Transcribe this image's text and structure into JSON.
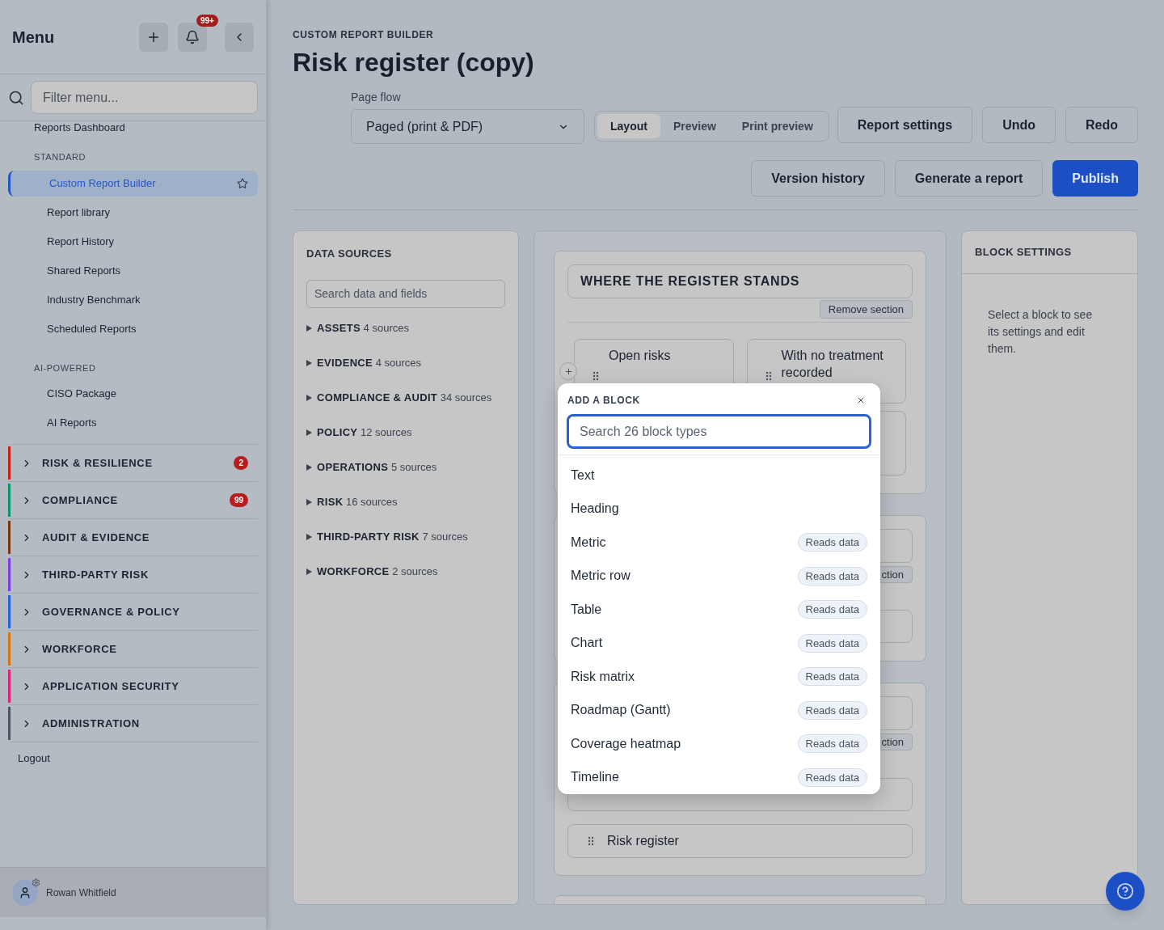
{
  "sidebar": {
    "title": "Menu",
    "notification_count": "99+",
    "filter": {
      "placeholder": "Filter menu..."
    },
    "top_link": "Reports Dashboard",
    "groups": [
      {
        "heading": "STANDARD",
        "items": [
          {
            "label": "Custom Report Builder",
            "selected": true
          },
          {
            "label": "Report library",
            "selected": false
          },
          {
            "label": "Report History",
            "selected": false
          },
          {
            "label": "Shared Reports",
            "selected": false
          },
          {
            "label": "Industry Benchmark",
            "selected": false
          },
          {
            "label": "Scheduled Reports",
            "selected": false
          }
        ]
      },
      {
        "heading": "AI-POWERED",
        "items": [
          {
            "label": "CISO Package",
            "selected": false
          },
          {
            "label": "AI Reports",
            "selected": false
          }
        ]
      }
    ],
    "sections": [
      {
        "label": "RISK & RESILIENCE",
        "color": "#c81e1e",
        "badge": "2"
      },
      {
        "label": "COMPLIANCE",
        "color": "#059669",
        "badge": "99"
      },
      {
        "label": "AUDIT & EVIDENCE",
        "color": "#78350f"
      },
      {
        "label": "THIRD-PARTY RISK",
        "color": "#7c3aed"
      },
      {
        "label": "GOVERNANCE & POLICY",
        "color": "#2563eb"
      },
      {
        "label": "WORKFORCE",
        "color": "#d97706"
      },
      {
        "label": "APPLICATION SECURITY",
        "color": "#db2777"
      },
      {
        "label": "ADMINISTRATION",
        "color": "#4b5563"
      }
    ],
    "logout": "Logout",
    "user": "Rowan Whitfield"
  },
  "header": {
    "eyebrow": "CUSTOM REPORT BUILDER",
    "title": "Risk register (copy)",
    "page_flow": {
      "label": "Page flow",
      "value": "Paged (print & PDF)"
    },
    "view_tabs": [
      {
        "label": "Layout",
        "selected": true
      },
      {
        "label": "Preview",
        "selected": false
      },
      {
        "label": "Print preview",
        "selected": false
      }
    ],
    "button_rows": [
      [
        {
          "label": "Report settings",
          "kind": "secondary"
        },
        {
          "label": "Undo",
          "kind": "secondary"
        },
        {
          "label": "Redo",
          "kind": "secondary"
        }
      ],
      [
        {
          "label": "Version history",
          "kind": "secondary"
        },
        {
          "label": "Generate a report",
          "kind": "secondary"
        },
        {
          "label": "Publish",
          "kind": "primary"
        }
      ]
    ]
  },
  "data_sources": {
    "title": "DATA SOURCES",
    "search": {
      "placeholder": "Search data and fields"
    },
    "groups": [
      {
        "name": "ASSETS",
        "count": "4 sources"
      },
      {
        "name": "EVIDENCE",
        "count": "4 sources"
      },
      {
        "name": "COMPLIANCE & AUDIT",
        "count": "34 sources"
      },
      {
        "name": "POLICY",
        "count": "12 sources"
      },
      {
        "name": "OPERATIONS",
        "count": "5 sources"
      },
      {
        "name": "RISK",
        "count": "16 sources"
      },
      {
        "name": "THIRD-PARTY RISK",
        "count": "7 sources"
      },
      {
        "name": "WORKFORCE",
        "count": "2 sources"
      }
    ]
  },
  "canvas": {
    "section_title": "WHERE THE REGISTER STANDS",
    "remove_button": "Remove section",
    "metric_cards": [
      "Open risks",
      "With no treatment recorded"
    ],
    "partial_buttons": [
      "ction",
      "ction"
    ],
    "last_block": "Risk register"
  },
  "add_block": {
    "title": "ADD A BLOCK",
    "search": {
      "placeholder": "Search 26 block types"
    },
    "items": [
      {
        "label": "Text"
      },
      {
        "label": "Heading"
      },
      {
        "label": "Metric",
        "tag": "Reads data"
      },
      {
        "label": "Metric row",
        "tag": "Reads data"
      },
      {
        "label": "Table",
        "tag": "Reads data"
      },
      {
        "label": "Chart",
        "tag": "Reads data"
      },
      {
        "label": "Risk matrix",
        "tag": "Reads data"
      },
      {
        "label": "Roadmap (Gantt)",
        "tag": "Reads data"
      },
      {
        "label": "Coverage heatmap",
        "tag": "Reads data"
      },
      {
        "label": "Timeline",
        "tag": "Reads data"
      }
    ]
  },
  "block_settings": {
    "title": "BLOCK SETTINGS",
    "hint": "Select a block to see its settings and edit them."
  }
}
